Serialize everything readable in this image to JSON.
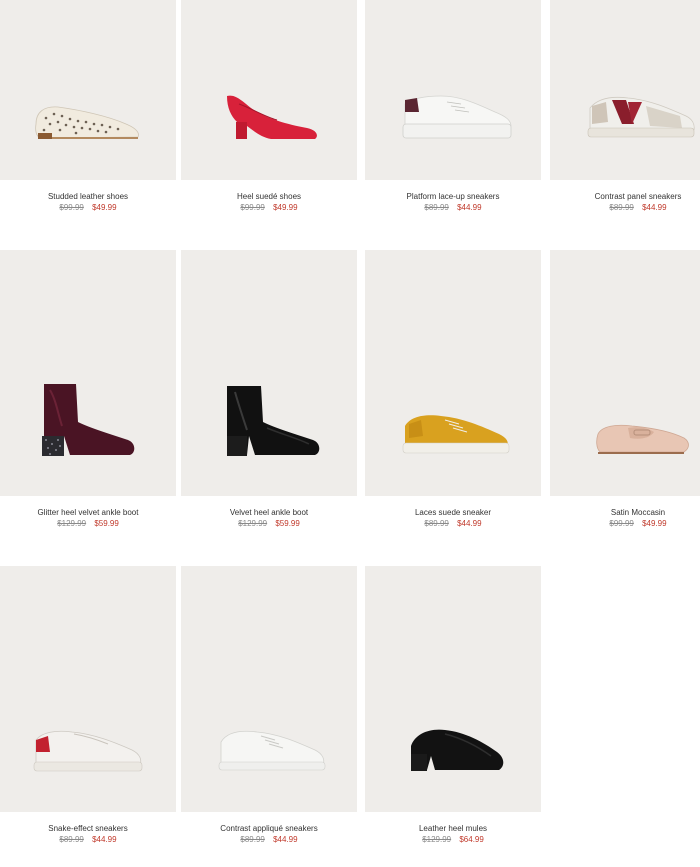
{
  "products": [
    {
      "name": "Studded leather shoes",
      "old_price": "$99.99",
      "price": "$49.99",
      "icon": "studded-flat-shoe-icon",
      "color": "#efe9dd"
    },
    {
      "name": "Heel suedé shoes",
      "old_price": "$99.99",
      "price": "$49.99",
      "icon": "red-block-heel-pump-icon",
      "color": "#d8213a"
    },
    {
      "name": "Platform lace-up sneakers",
      "old_price": "$89.99",
      "price": "$44.99",
      "icon": "white-platform-sneaker-icon",
      "color": "#f6f6f4"
    },
    {
      "name": "Contrast panel sneakers",
      "old_price": "$89.99",
      "price": "$44.99",
      "icon": "contrast-panel-sneaker-icon",
      "color": "#8a1e2c"
    },
    {
      "name": "Glitter heel velvet ankle boot",
      "old_price": "$129.99",
      "price": "$59.99",
      "icon": "velvet-ankle-boot-icon",
      "color": "#4a1424"
    },
    {
      "name": "Velvet heel ankle boot",
      "old_price": "$129.99",
      "price": "$59.99",
      "icon": "black-velvet-ankle-boot-icon",
      "color": "#111111"
    },
    {
      "name": "Laces suede sneaker",
      "old_price": "$89.99",
      "price": "$44.99",
      "icon": "mustard-suede-sneaker-icon",
      "color": "#d9a11f"
    },
    {
      "name": "Satin Moccasin",
      "old_price": "$99.99",
      "price": "$49.99",
      "icon": "satin-moccasin-icon",
      "color": "#e8c6b4"
    },
    {
      "name": "Snake-effect sneakers",
      "old_price": "$89.99",
      "price": "$44.99",
      "icon": "snake-effect-sneaker-icon",
      "color": "#f3f1ee"
    },
    {
      "name": "Contrast appliqué sneakers",
      "old_price": "$89.99",
      "price": "$44.99",
      "icon": "white-applique-sneaker-icon",
      "color": "#f4f4f2"
    },
    {
      "name": "Leather heel mules",
      "old_price": "$129.99",
      "price": "$64.99",
      "icon": "black-heel-mule-icon",
      "color": "#121212"
    }
  ]
}
